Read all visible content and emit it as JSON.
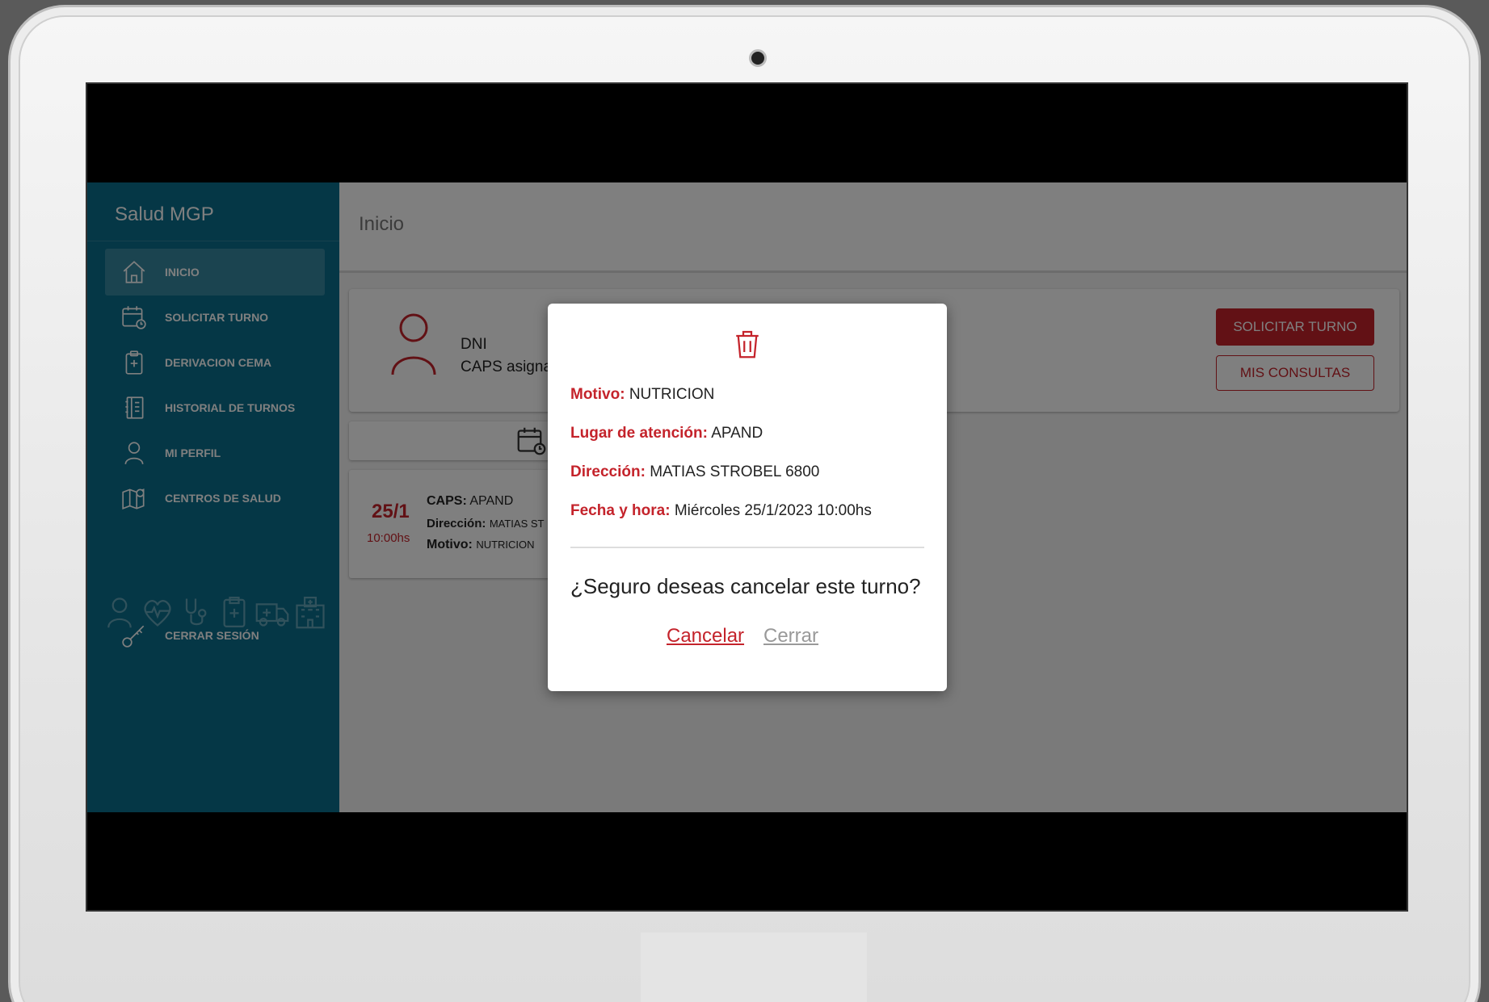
{
  "app": {
    "brand": "Salud MGP"
  },
  "sidebar": {
    "items": [
      {
        "label": "INICIO",
        "icon": "home-icon"
      },
      {
        "label": "SOLICITAR TURNO",
        "icon": "calendar-clock-icon"
      },
      {
        "label": "DERIVACION CEMA",
        "icon": "clipboard-plus-icon"
      },
      {
        "label": "HISTORIAL DE TURNOS",
        "icon": "notebook-icon"
      },
      {
        "label": "MI PERFIL",
        "icon": "user-icon"
      },
      {
        "label": "CENTROS DE SALUD",
        "icon": "map-pin-icon"
      }
    ],
    "logout": {
      "label": "CERRAR SESIÓN",
      "icon": "key-icon"
    }
  },
  "main": {
    "page_title": "Inicio",
    "user_card": {
      "dni_label": "DNI",
      "caps_label": "CAPS asigna",
      "request_button": "SOLICITAR TURNO",
      "consults_button": "MIS CONSULTAS"
    },
    "appointment": {
      "day": "25/1",
      "time": "10:00hs",
      "caps_label": "CAPS:",
      "caps_value": "APAND",
      "address_label": "Dirección:",
      "address_value": "MATIAS ST",
      "reason_label": "Motivo:",
      "reason_value": "NUTRICION"
    }
  },
  "modal": {
    "icon": "trash-icon",
    "reason_label": "Motivo:",
    "reason_value": "NUTRICION",
    "place_label": "Lugar de atención:",
    "place_value": "APAND",
    "address_label": "Dirección:",
    "address_value": "MATIAS STROBEL 6800",
    "datetime_label": "Fecha y hora:",
    "datetime_value": "Miércoles 25/1/2023 10:00hs",
    "question": "¿Seguro deseas cancelar este turno?",
    "cancel_label": "Cancelar",
    "close_label": "Cerrar"
  },
  "colors": {
    "primary": "#c4232b",
    "sidebar": "#0a6e8c"
  }
}
